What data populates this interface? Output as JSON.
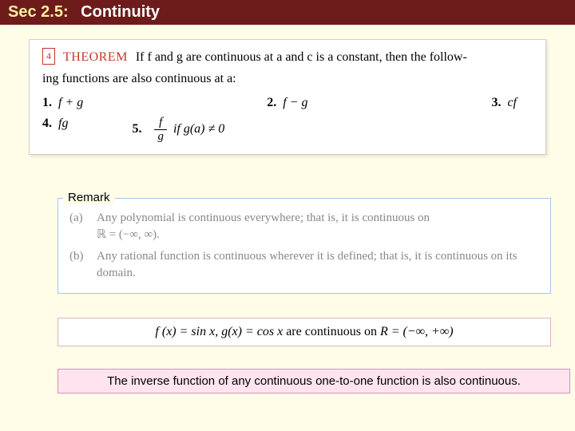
{
  "header": {
    "sec": "Sec 2.5:",
    "title": "Continuity"
  },
  "theorem": {
    "boxnum": "4",
    "label": "THEOREM",
    "line1": "If  f  and g are continuous at a and c is a constant, then the follow-",
    "line2": "ing functions are also continuous at a:",
    "items": {
      "n1": "1.",
      "e1": "f + g",
      "n2": "2.",
      "e2": "f − g",
      "n3": "3.",
      "e3": "cf",
      "n4": "4.",
      "e4": "fg",
      "n5": "5.",
      "frac_top": "f",
      "frac_bot": "g",
      "cond": " if g(a) ≠ 0"
    }
  },
  "remark": {
    "title": "Remark",
    "a_label": "(a)",
    "a_text": "Any polynomial is continuous everywhere; that is, it is continuous on",
    "a_set": "ℝ = (−∞, ∞).",
    "b_label": "(b)",
    "b_text": "Any rational function is continuous wherever it is defined; that is, it is continuous on its domain."
  },
  "sincos": {
    "pre": "f (x) = sin x,   g(x) = cos x",
    "mid": "  are continuous on  ",
    "post": "R = (−∞, +∞)"
  },
  "inverse": {
    "text": "The inverse function of any continuous one-to-one function is also continuous."
  }
}
